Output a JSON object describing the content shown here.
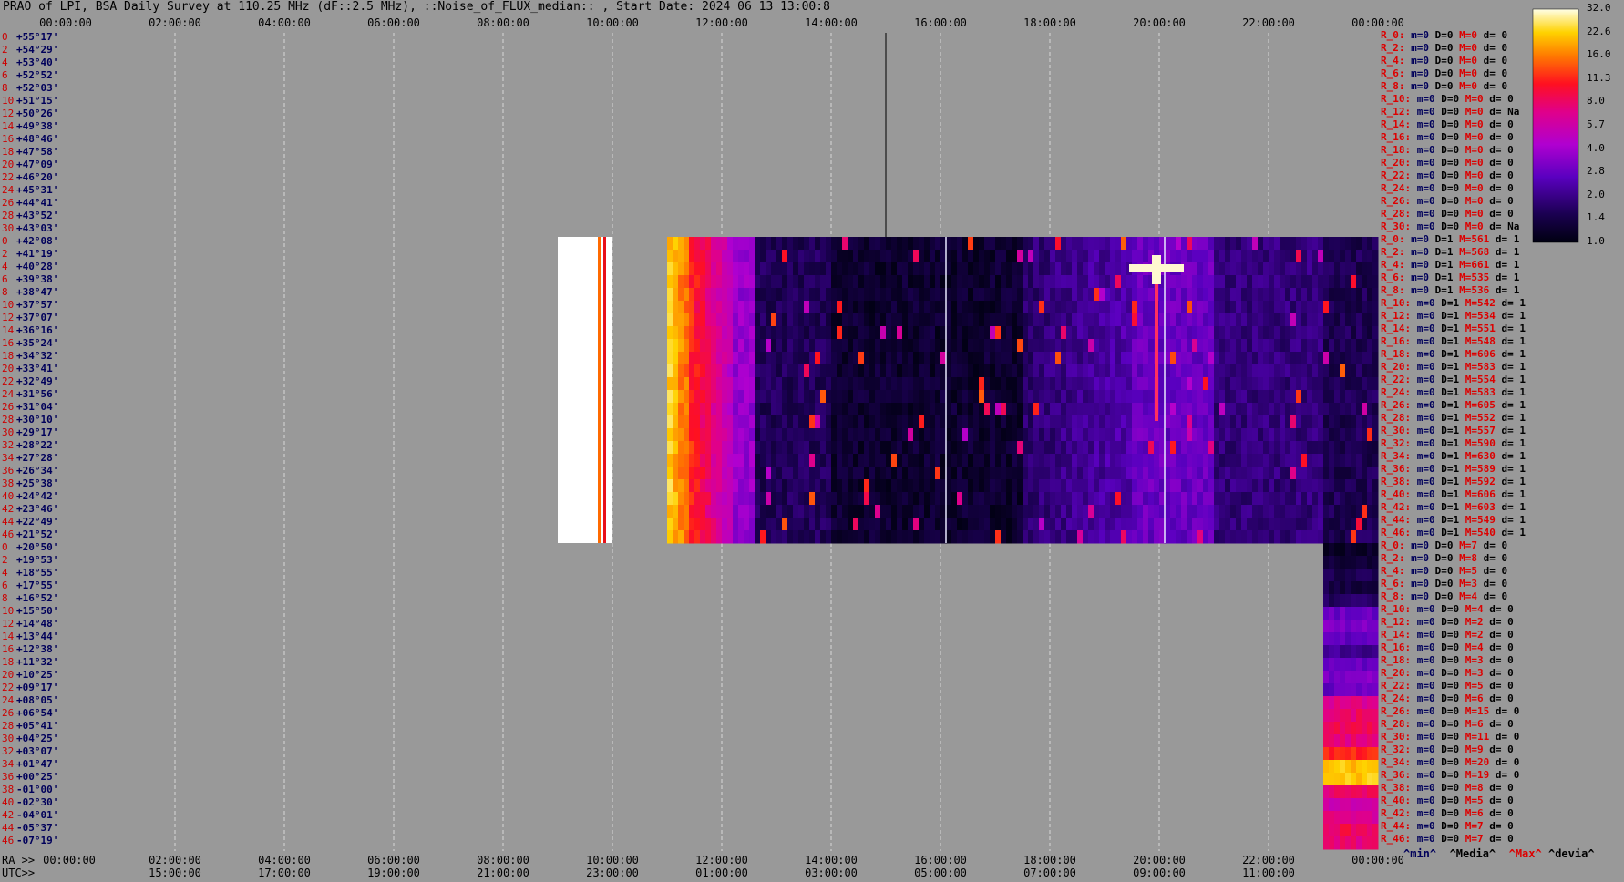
{
  "title": "PRAO of LPI, BSA Daily Survey at 110.25 MHz (dF::2.5 MHz), ::Noise_of_FLUX_median:: , Start Date: 2024 06 13 13:00:8",
  "chart_data": {
    "type": "heatmap",
    "title": "PRAO of LPI, BSA Daily Survey at 110.25 MHz (dF::2.5 MHz), ::Noise_of_FLUX_median:: , Start Date: 2024 06 13 13:00:8",
    "x_top_ticks": [
      "00:00:00",
      "02:00:00",
      "04:00:00",
      "06:00:00",
      "08:00:00",
      "10:00:00",
      "12:00:00",
      "14:00:00",
      "16:00:00",
      "18:00:00",
      "20:00:00",
      "22:00:00",
      "00:00:00"
    ],
    "x_bottom_ra_label": "RA >>",
    "x_bottom_ticks": [
      "00:00:00",
      "02:00:00",
      "04:00:00",
      "06:00:00",
      "08:00:00",
      "10:00:00",
      "12:00:00",
      "14:00:00",
      "16:00:00",
      "18:00:00",
      "20:00:00",
      "22:00:00",
      "00:00:00"
    ],
    "x_utc_label": "UTC>>",
    "x_utc_ticks": [
      "15:00:00",
      "17:00:00",
      "19:00:00",
      "21:00:00",
      "23:00:00",
      "01:00:00",
      "03:00:00",
      "05:00:00",
      "07:00:00",
      "09:00:00",
      "11:00:00"
    ],
    "y_labels": [
      "+55°17'",
      "+54°29'",
      "+53°40'",
      "+52°52'",
      "+52°03'",
      "+51°15'",
      "+50°26'",
      "+49°38'",
      "+48°46'",
      "+47°58'",
      "+47°09'",
      "+46°20'",
      "+45°31'",
      "+44°41'",
      "+43°52'",
      "+43°03'",
      "+42°08'",
      "+41°19'",
      "+40°28'",
      "+39°38'",
      "+38°47'",
      "+37°57'",
      "+37°07'",
      "+36°16'",
      "+35°24'",
      "+34°32'",
      "+33°41'",
      "+32°49'",
      "+31°56'",
      "+31°04'",
      "+30°10'",
      "+29°17'",
      "+28°22'",
      "+27°28'",
      "+26°34'",
      "+25°38'",
      "+24°42'",
      "+23°46'",
      "+22°49'",
      "+21°52'",
      "+20°50'",
      "+19°53'",
      "+18°55'",
      "+17°55'",
      "+16°52'",
      "+15°50'",
      "+14°48'",
      "+13°44'",
      "+12°38'",
      "+11°32'",
      "+10°25'",
      "+09°17'",
      "+08°05'",
      "+06°54'",
      "+05°41'",
      "+04°25'",
      "+03°07'",
      "+01°47'",
      "+00°25'",
      "-01°00'",
      "-02°30'",
      "-04°01'",
      "-05°37'",
      "-07°19'"
    ],
    "y_index": [
      "0",
      "2",
      "4",
      "6",
      "8",
      "10",
      "12",
      "14",
      "16",
      "18",
      "20",
      "22",
      "24",
      "26",
      "28",
      "30",
      "0",
      "2",
      "4",
      "6",
      "8",
      "10",
      "12",
      "14",
      "16",
      "18",
      "20",
      "22",
      "24",
      "26",
      "28",
      "30",
      "32",
      "34",
      "36",
      "38",
      "40",
      "42",
      "44",
      "46",
      "0",
      "2",
      "4",
      "6",
      "8",
      "10",
      "12",
      "14",
      "16",
      "18",
      "20",
      "22",
      "24",
      "26",
      "28",
      "30",
      "32",
      "34",
      "36",
      "38",
      "40",
      "42",
      "44",
      "46"
    ],
    "colorbar": {
      "ticks": [
        "32.0",
        "22.6",
        "16.0",
        "11.3",
        "8.0",
        "5.7",
        "4.0",
        "2.8",
        "2.0",
        "1.4",
        "1.0"
      ],
      "scale": "log",
      "range": [
        1.0,
        32.0
      ]
    },
    "data_blocks": [
      {
        "name": "block-A-white",
        "x_range_hours": [
          9.0,
          10.0
        ],
        "rows": [
          16,
          39
        ],
        "level": "saturated"
      },
      {
        "name": "block-B-main",
        "x_range_hours": [
          11.0,
          24.0
        ],
        "rows": [
          16,
          39
        ],
        "level": "mixed"
      },
      {
        "name": "block-C-strip",
        "x_range_hours": [
          23.0,
          24.0
        ],
        "rows": [
          40,
          63
        ],
        "level": "mixed"
      }
    ],
    "grid": true
  },
  "stats": {
    "rows": [
      {
        "r": "R_0:",
        "m": "m=0",
        "D": "D=0",
        "M": "M=0",
        "d": "d= 0"
      },
      {
        "r": "R_2:",
        "m": "m=0",
        "D": "D=0",
        "M": "M=0",
        "d": "d= 0"
      },
      {
        "r": "R_4:",
        "m": "m=0",
        "D": "D=0",
        "M": "M=0",
        "d": "d= 0"
      },
      {
        "r": "R_6:",
        "m": "m=0",
        "D": "D=0",
        "M": "M=0",
        "d": "d= 0"
      },
      {
        "r": "R_8:",
        "m": "m=0",
        "D": "D=0",
        "M": "M=0",
        "d": "d= 0"
      },
      {
        "r": "R_10:",
        "m": "m=0",
        "D": "D=0",
        "M": "M=0",
        "d": "d= 0"
      },
      {
        "r": "R_12:",
        "m": "m=0",
        "D": "D=0",
        "M": "M=0",
        "d": "d= Na"
      },
      {
        "r": "R_14:",
        "m": "m=0",
        "D": "D=0",
        "M": "M=0",
        "d": "d= 0"
      },
      {
        "r": "R_16:",
        "m": "m=0",
        "D": "D=0",
        "M": "M=0",
        "d": "d= 0"
      },
      {
        "r": "R_18:",
        "m": "m=0",
        "D": "D=0",
        "M": "M=0",
        "d": "d= 0"
      },
      {
        "r": "R_20:",
        "m": "m=0",
        "D": "D=0",
        "M": "M=0",
        "d": "d= 0"
      },
      {
        "r": "R_22:",
        "m": "m=0",
        "D": "D=0",
        "M": "M=0",
        "d": "d= 0"
      },
      {
        "r": "R_24:",
        "m": "m=0",
        "D": "D=0",
        "M": "M=0",
        "d": "d= 0"
      },
      {
        "r": "R_26:",
        "m": "m=0",
        "D": "D=0",
        "M": "M=0",
        "d": "d= 0"
      },
      {
        "r": "R_28:",
        "m": "m=0",
        "D": "D=0",
        "M": "M=0",
        "d": "d= 0"
      },
      {
        "r": "R_30:",
        "m": "m=0",
        "D": "D=0",
        "M": "M=0",
        "d": "d= Na"
      },
      {
        "r": "R_0:",
        "m": "m=0",
        "D": "D=1",
        "M": "M=561",
        "d": "d= 1"
      },
      {
        "r": "R_2:",
        "m": "m=0",
        "D": "D=1",
        "M": "M=568",
        "d": "d= 1"
      },
      {
        "r": "R_4:",
        "m": "m=0",
        "D": "D=1",
        "M": "M=661",
        "d": "d= 1"
      },
      {
        "r": "R_6:",
        "m": "m=0",
        "D": "D=1",
        "M": "M=535",
        "d": "d= 1"
      },
      {
        "r": "R_8:",
        "m": "m=0",
        "D": "D=1",
        "M": "M=536",
        "d": "d= 1"
      },
      {
        "r": "R_10:",
        "m": "m=0",
        "D": "D=1",
        "M": "M=542",
        "d": "d= 1"
      },
      {
        "r": "R_12:",
        "m": "m=0",
        "D": "D=1",
        "M": "M=534",
        "d": "d= 1"
      },
      {
        "r": "R_14:",
        "m": "m=0",
        "D": "D=1",
        "M": "M=551",
        "d": "d= 1"
      },
      {
        "r": "R_16:",
        "m": "m=0",
        "D": "D=1",
        "M": "M=548",
        "d": "d= 1"
      },
      {
        "r": "R_18:",
        "m": "m=0",
        "D": "D=1",
        "M": "M=606",
        "d": "d= 1"
      },
      {
        "r": "R_20:",
        "m": "m=0",
        "D": "D=1",
        "M": "M=583",
        "d": "d= 1"
      },
      {
        "r": "R_22:",
        "m": "m=0",
        "D": "D=1",
        "M": "M=554",
        "d": "d= 1"
      },
      {
        "r": "R_24:",
        "m": "m=0",
        "D": "D=1",
        "M": "M=583",
        "d": "d= 1"
      },
      {
        "r": "R_26:",
        "m": "m=0",
        "D": "D=1",
        "M": "M=605",
        "d": "d= 1"
      },
      {
        "r": "R_28:",
        "m": "m=0",
        "D": "D=1",
        "M": "M=552",
        "d": "d= 1"
      },
      {
        "r": "R_30:",
        "m": "m=0",
        "D": "D=1",
        "M": "M=557",
        "d": "d= 1"
      },
      {
        "r": "R_32:",
        "m": "m=0",
        "D": "D=1",
        "M": "M=590",
        "d": "d= 1"
      },
      {
        "r": "R_34:",
        "m": "m=0",
        "D": "D=1",
        "M": "M=630",
        "d": "d= 1"
      },
      {
        "r": "R_36:",
        "m": "m=0",
        "D": "D=1",
        "M": "M=589",
        "d": "d= 1"
      },
      {
        "r": "R_38:",
        "m": "m=0",
        "D": "D=1",
        "M": "M=592",
        "d": "d= 1"
      },
      {
        "r": "R_40:",
        "m": "m=0",
        "D": "D=1",
        "M": "M=606",
        "d": "d= 1"
      },
      {
        "r": "R_42:",
        "m": "m=0",
        "D": "D=1",
        "M": "M=603",
        "d": "d= 1"
      },
      {
        "r": "R_44:",
        "m": "m=0",
        "D": "D=1",
        "M": "M=549",
        "d": "d= 1"
      },
      {
        "r": "R_46:",
        "m": "m=0",
        "D": "D=1",
        "M": "M=540",
        "d": "d= 1"
      },
      {
        "r": "R_0:",
        "m": "m=0",
        "D": "D=0",
        "M": "M=7",
        "d": "d= 0"
      },
      {
        "r": "R_2:",
        "m": "m=0",
        "D": "D=0",
        "M": "M=8",
        "d": "d= 0"
      },
      {
        "r": "R_4:",
        "m": "m=0",
        "D": "D=0",
        "M": "M=5",
        "d": "d= 0"
      },
      {
        "r": "R_6:",
        "m": "m=0",
        "D": "D=0",
        "M": "M=3",
        "d": "d= 0"
      },
      {
        "r": "R_8:",
        "m": "m=0",
        "D": "D=0",
        "M": "M=4",
        "d": "d= 0"
      },
      {
        "r": "R_10:",
        "m": "m=0",
        "D": "D=0",
        "M": "M=4",
        "d": "d= 0"
      },
      {
        "r": "R_12:",
        "m": "m=0",
        "D": "D=0",
        "M": "M=2",
        "d": "d= 0"
      },
      {
        "r": "R_14:",
        "m": "m=0",
        "D": "D=0",
        "M": "M=2",
        "d": "d= 0"
      },
      {
        "r": "R_16:",
        "m": "m=0",
        "D": "D=0",
        "M": "M=4",
        "d": "d= 0"
      },
      {
        "r": "R_18:",
        "m": "m=0",
        "D": "D=0",
        "M": "M=3",
        "d": "d= 0"
      },
      {
        "r": "R_20:",
        "m": "m=0",
        "D": "D=0",
        "M": "M=3",
        "d": "d= 0"
      },
      {
        "r": "R_22:",
        "m": "m=0",
        "D": "D=0",
        "M": "M=5",
        "d": "d= 0"
      },
      {
        "r": "R_24:",
        "m": "m=0",
        "D": "D=0",
        "M": "M=6",
        "d": "d= 0"
      },
      {
        "r": "R_26:",
        "m": "m=0",
        "D": "D=0",
        "M": "M=15",
        "d": "d= 0"
      },
      {
        "r": "R_28:",
        "m": "m=0",
        "D": "D=0",
        "M": "M=6",
        "d": "d= 0"
      },
      {
        "r": "R_30:",
        "m": "m=0",
        "D": "D=0",
        "M": "M=11",
        "d": "d= 0"
      },
      {
        "r": "R_32:",
        "m": "m=0",
        "D": "D=0",
        "M": "M=9",
        "d": "d= 0"
      },
      {
        "r": "R_34:",
        "m": "m=0",
        "D": "D=0",
        "M": "M=20",
        "d": "d= 0"
      },
      {
        "r": "R_36:",
        "m": "m=0",
        "D": "D=0",
        "M": "M=19",
        "d": "d= 0"
      },
      {
        "r": "R_38:",
        "m": "m=0",
        "D": "D=0",
        "M": "M=8",
        "d": "d= 0"
      },
      {
        "r": "R_40:",
        "m": "m=0",
        "D": "D=0",
        "M": "M=5",
        "d": "d= 0"
      },
      {
        "r": "R_42:",
        "m": "m=0",
        "D": "D=0",
        "M": "M=6",
        "d": "d= 0"
      },
      {
        "r": "R_44:",
        "m": "m=0",
        "D": "D=0",
        "M": "M=7",
        "d": "d= 0"
      },
      {
        "r": "R_46:",
        "m": "m=0",
        "D": "D=0",
        "M": "M=7",
        "d": "d= 0"
      }
    ]
  },
  "legend": {
    "min": "^min^",
    "median": "^Media^",
    "max": "^Max^",
    "dev": "^devia^"
  },
  "colors": {
    "background": "#999999",
    "grid": "#cfcfcf",
    "index": "#cc0000",
    "dec": "#00005a"
  }
}
